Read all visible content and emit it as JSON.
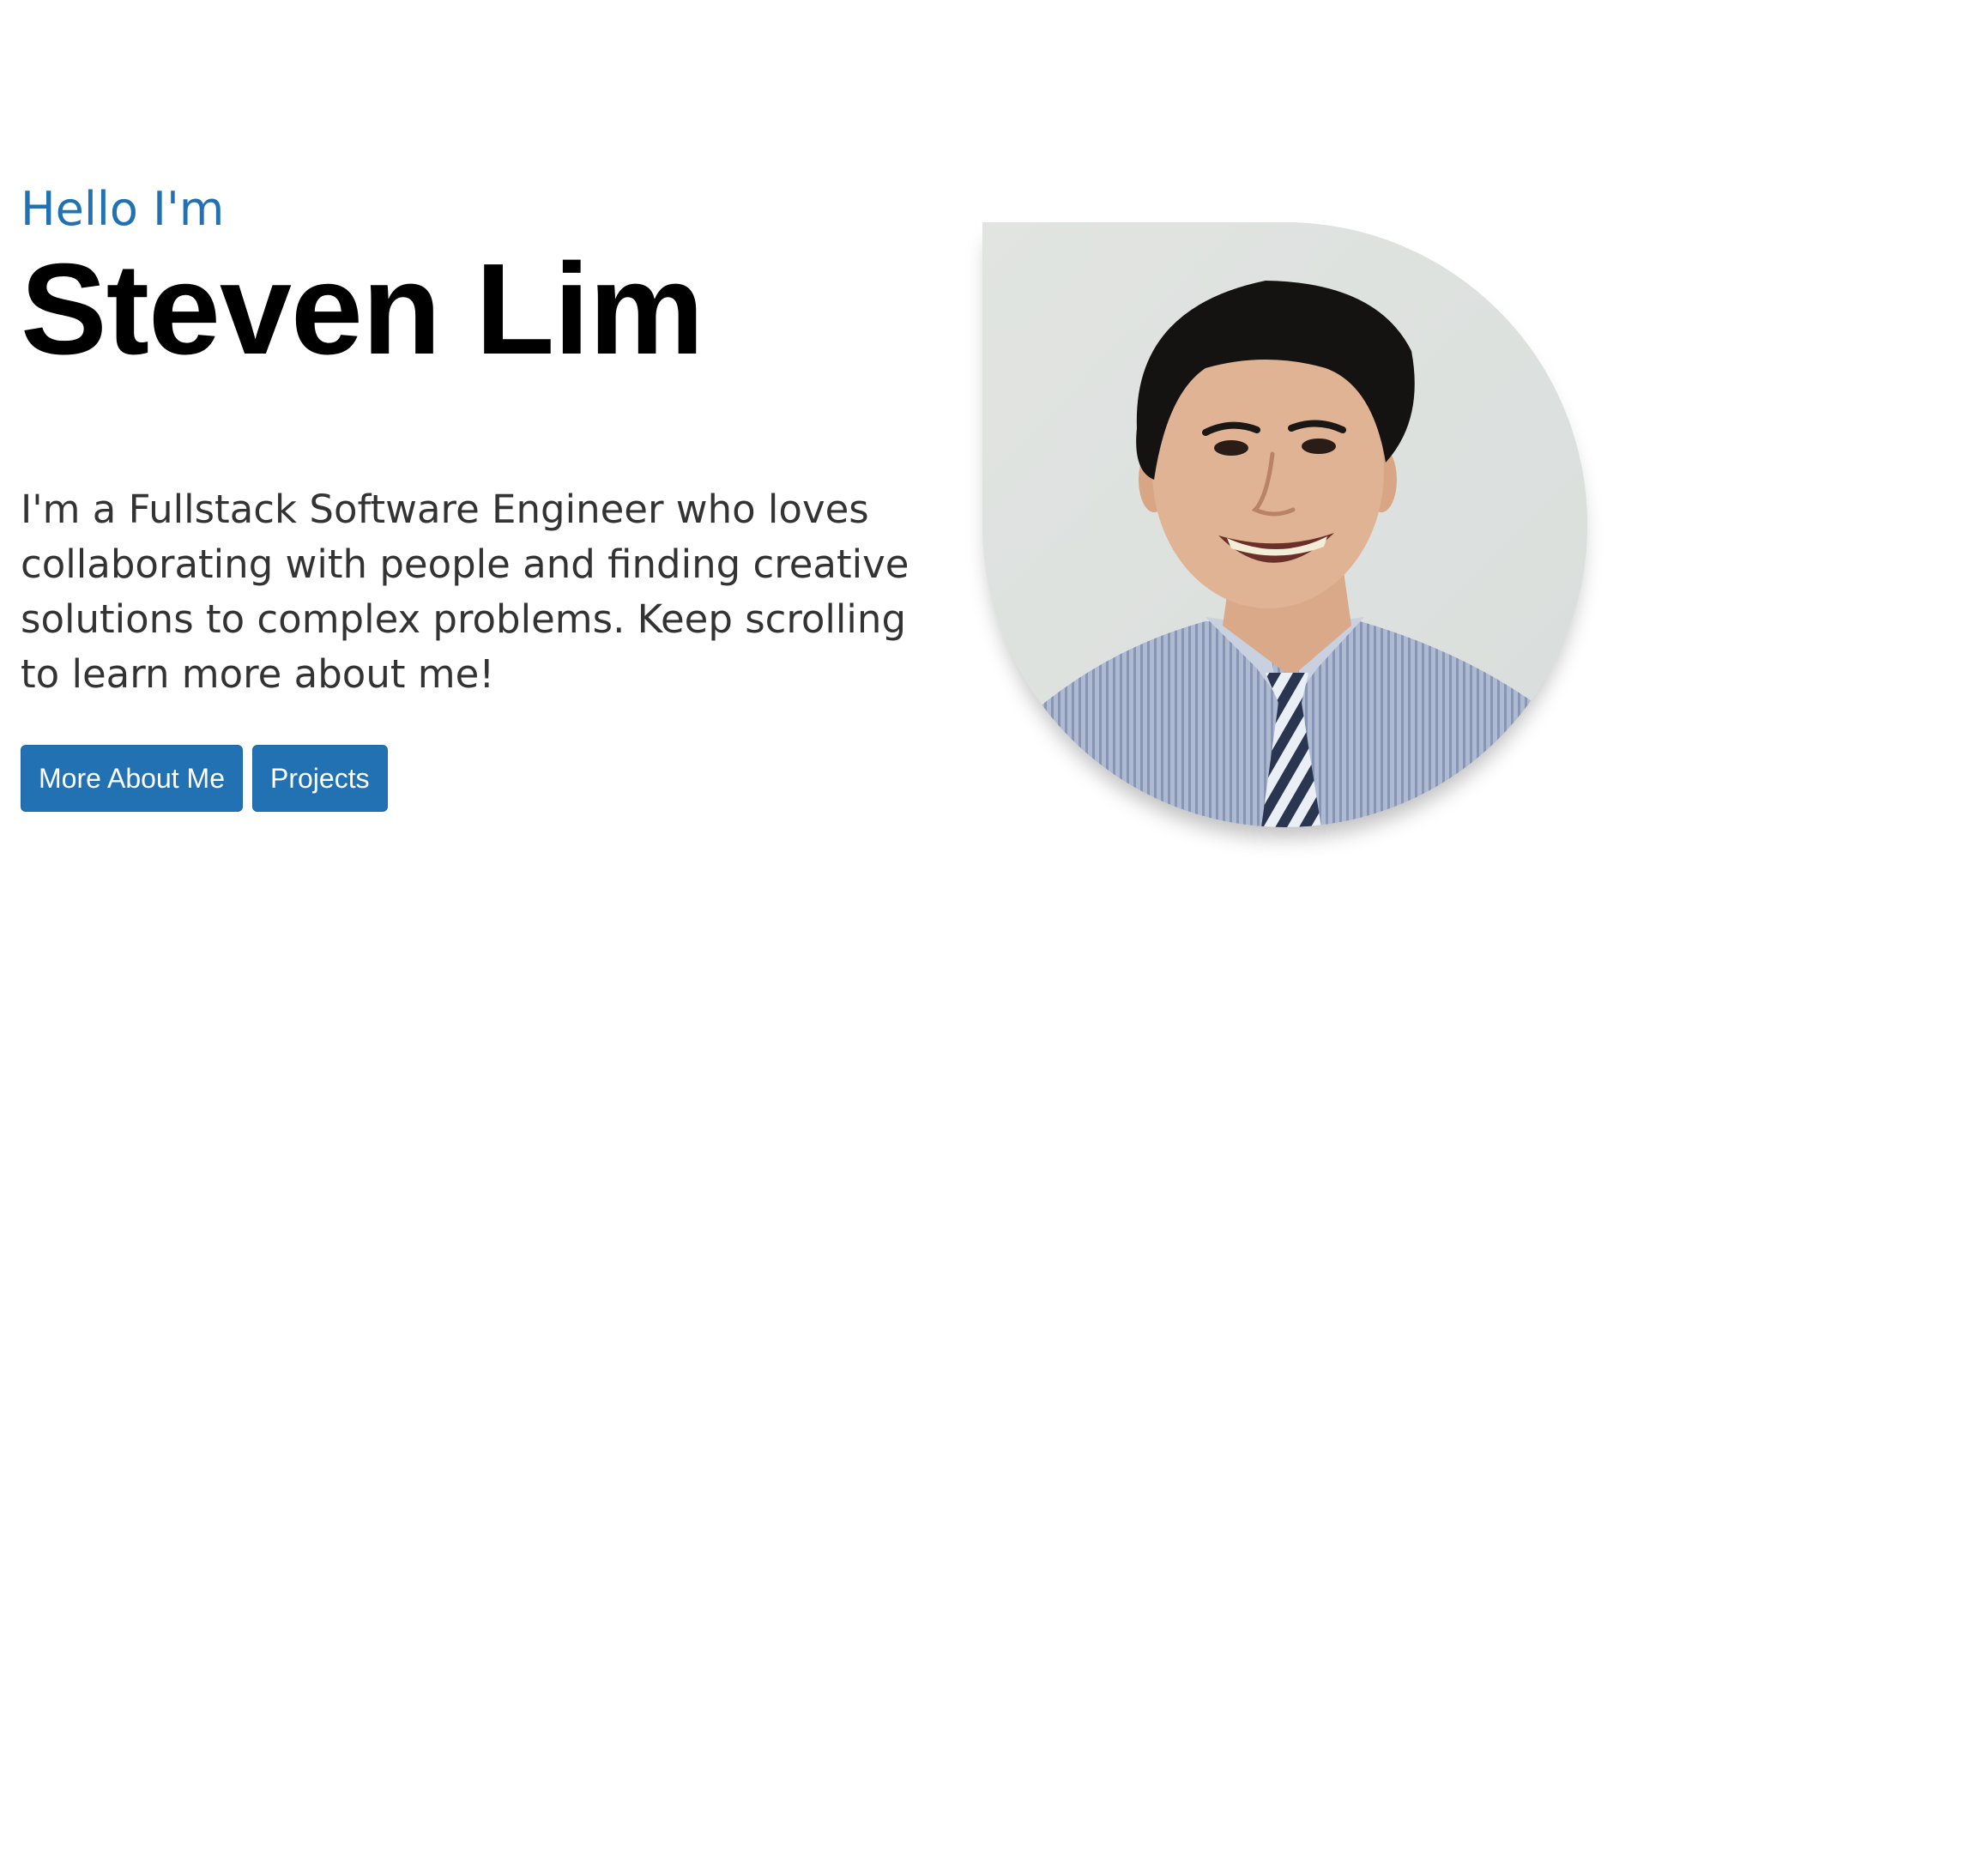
{
  "hero": {
    "greeting": "Hello I'm",
    "name": "Steven Lim",
    "intro": "I'm a Fullstack Software Engineer who loves collaborating with people and finding creative solutions to complex problems. Keep scrolling to learn more about me!",
    "buttons": {
      "about_label": "More About Me",
      "projects_label": "Projects"
    }
  },
  "portrait": {
    "alt": "Steven Lim"
  },
  "colors": {
    "accent": "#2272b3",
    "heading": "#000000",
    "body_text": "#333333",
    "background": "#ffffff"
  }
}
